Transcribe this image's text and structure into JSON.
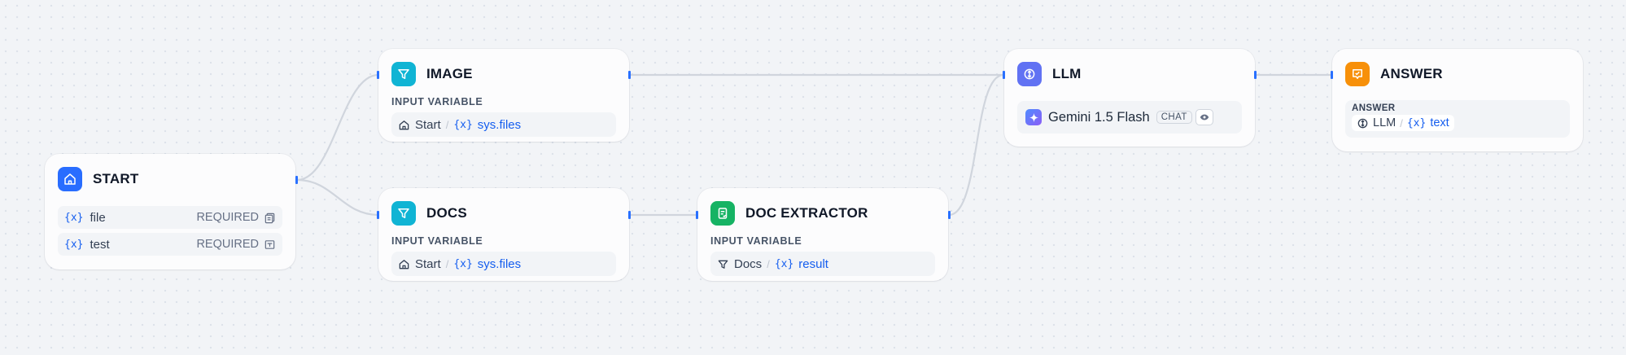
{
  "colors": {
    "start_icon_bg": "#296dff",
    "filter_icon_bg": "#10b4d4",
    "doc_extractor_icon_bg": "#16b364",
    "llm_icon_bg": "#6172f3",
    "answer_icon_bg": "#f79009",
    "variable_blue": "#155eef",
    "edge": "#d0d5dd",
    "handle": "#2970ff"
  },
  "nodes": {
    "start": {
      "title": "START",
      "icon": "home-icon",
      "variables": [
        {
          "x_label": "{x}",
          "name": "file",
          "status": "REQUIRED",
          "type_icon": "file-list-icon"
        },
        {
          "x_label": "{x}",
          "name": "test",
          "status": "REQUIRED",
          "type_icon": "text-input-icon"
        }
      ]
    },
    "image": {
      "title": "IMAGE",
      "icon": "filter-icon",
      "section_label": "INPUT VARIABLE",
      "source": "Start",
      "source_icon": "home-icon",
      "separator": "/",
      "x_label": "{x}",
      "variable": "sys.files"
    },
    "docs": {
      "title": "DOCS",
      "icon": "filter-icon",
      "section_label": "INPUT VARIABLE",
      "source": "Start",
      "source_icon": "home-icon",
      "separator": "/",
      "x_label": "{x}",
      "variable": "sys.files"
    },
    "doc_extractor": {
      "title": "DOC EXTRACTOR",
      "icon": "document-icon",
      "section_label": "INPUT VARIABLE",
      "source": "Docs",
      "source_icon": "filter-icon",
      "separator": "/",
      "x_label": "{x}",
      "variable": "result"
    },
    "llm": {
      "title": "LLM",
      "icon": "llm-icon",
      "model": "Gemini 1.5 Flash",
      "model_icon": "gemini-sparkle-icon",
      "mode_badge": "CHAT",
      "vision_icon": "eye-icon"
    },
    "answer": {
      "title": "ANSWER",
      "icon": "answer-icon",
      "section_label": "ANSWER",
      "source": "LLM",
      "source_icon": "llm-icon",
      "separator": "/",
      "x_label": "{x}",
      "variable": "text"
    }
  }
}
